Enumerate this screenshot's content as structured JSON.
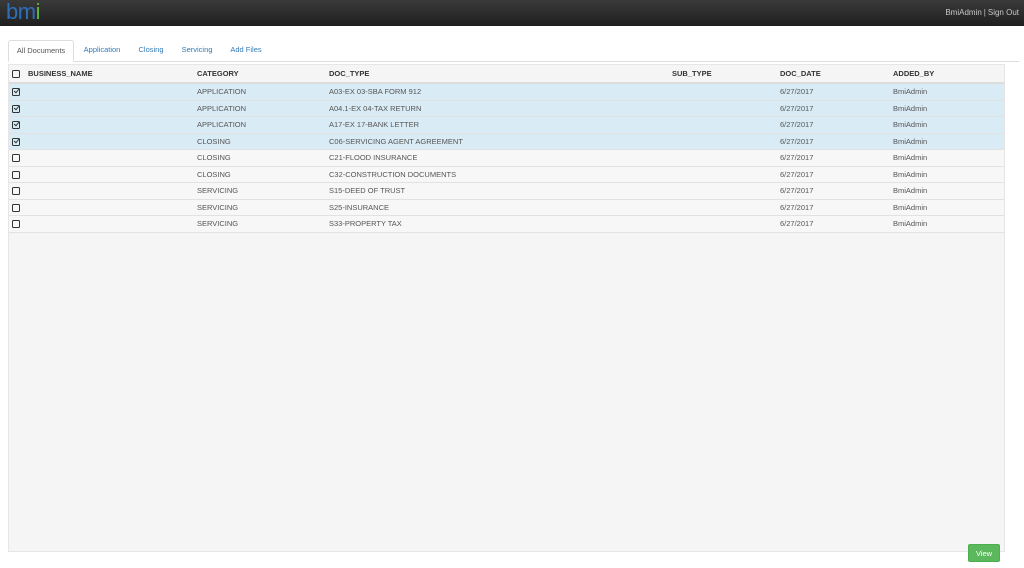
{
  "header": {
    "logo_text": "bm",
    "logo_i": "i",
    "user_name": "BmiAdmin",
    "separator": "|",
    "sign_out_label": "Sign Out"
  },
  "tabs": [
    {
      "label": "All Documents",
      "active": true
    },
    {
      "label": "Application",
      "active": false
    },
    {
      "label": "Closing",
      "active": false
    },
    {
      "label": "Servicing",
      "active": false
    },
    {
      "label": "Add Files",
      "active": false
    }
  ],
  "table": {
    "columns": [
      "BUSINESS_NAME",
      "CATEGORY",
      "DOC_TYPE",
      "SUB_TYPE",
      "DOC_DATE",
      "ADDED_BY"
    ],
    "rows": [
      {
        "checked": true,
        "business_name": "",
        "category": "APPLICATION",
        "doc_type": "A03-EX 03-SBA FORM 912",
        "sub_type": "",
        "doc_date": "6/27/2017",
        "added_by": "BmiAdmin"
      },
      {
        "checked": true,
        "business_name": "",
        "category": "APPLICATION",
        "doc_type": "A04.1-EX 04-TAX RETURN",
        "sub_type": "",
        "doc_date": "6/27/2017",
        "added_by": "BmiAdmin"
      },
      {
        "checked": true,
        "business_name": "",
        "category": "APPLICATION",
        "doc_type": "A17-EX 17-BANK LETTER",
        "sub_type": "",
        "doc_date": "6/27/2017",
        "added_by": "BmiAdmin"
      },
      {
        "checked": true,
        "business_name": "",
        "category": "CLOSING",
        "doc_type": "C06-SERVICING AGENT AGREEMENT",
        "sub_type": "",
        "doc_date": "6/27/2017",
        "added_by": "BmiAdmin"
      },
      {
        "checked": false,
        "business_name": "",
        "category": "CLOSING",
        "doc_type": "C21-FLOOD INSURANCE",
        "sub_type": "",
        "doc_date": "6/27/2017",
        "added_by": "BmiAdmin"
      },
      {
        "checked": false,
        "business_name": "",
        "category": "CLOSING",
        "doc_type": "C32-CONSTRUCTION DOCUMENTS",
        "sub_type": "",
        "doc_date": "6/27/2017",
        "added_by": "BmiAdmin"
      },
      {
        "checked": false,
        "business_name": "",
        "category": "SERVICING",
        "doc_type": "S15-DEED OF TRUST",
        "sub_type": "",
        "doc_date": "6/27/2017",
        "added_by": "BmiAdmin"
      },
      {
        "checked": false,
        "business_name": "",
        "category": "SERVICING",
        "doc_type": "S25-INSURANCE",
        "sub_type": "",
        "doc_date": "6/27/2017",
        "added_by": "BmiAdmin"
      },
      {
        "checked": false,
        "business_name": "",
        "category": "SERVICING",
        "doc_type": "S33-PROPERTY TAX",
        "sub_type": "",
        "doc_date": "6/27/2017",
        "added_by": "BmiAdmin"
      }
    ]
  },
  "footer": {
    "view_label": "View"
  },
  "colors": {
    "accent": "#337ab7",
    "selected_row": "#d9ebf5",
    "view_button": "#5cb85c",
    "logo_blue": "#2f6fb8",
    "logo_green": "#5fb845"
  }
}
